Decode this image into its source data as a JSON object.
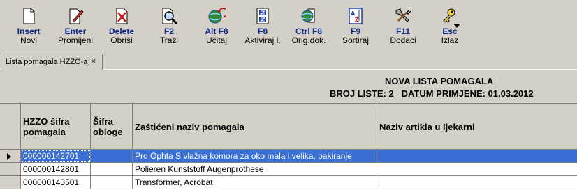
{
  "toolbar": {
    "buttons": [
      {
        "key": "Insert",
        "label": "Novi",
        "icon": "new-document-icon"
      },
      {
        "key": "Enter",
        "label": "Promijeni",
        "icon": "edit-document-icon"
      },
      {
        "key": "Delete",
        "label": "Obriši",
        "icon": "delete-document-icon"
      },
      {
        "key": "F2",
        "label": "Traži",
        "icon": "search-icon"
      },
      {
        "key": "Alt F8",
        "label": "Učitaj",
        "icon": "globe-refresh-icon"
      },
      {
        "key": "F8",
        "label": "Aktiviraj l.",
        "icon": "activate-list-icon"
      },
      {
        "key": "Ctrl F8",
        "label": "Orig.dok.",
        "icon": "globe-document-icon"
      },
      {
        "key": "F9",
        "label": "Sortiraj",
        "icon": "sort-az-icon"
      },
      {
        "key": "F11",
        "label": "Dodaci",
        "icon": "tools-icon"
      },
      {
        "key": "Esc",
        "label": "Izlaz",
        "icon": "exit-key-icon"
      }
    ]
  },
  "tab": {
    "label": "Lista pomagala HZZO-a",
    "close": "×"
  },
  "info": {
    "title": "NOVA LISTA POMAGALA",
    "line": "BROJ LISTE: 2   DATUM PRIMJENE: 01.03.2012"
  },
  "grid": {
    "columns": [
      {
        "line1": "HZZO šifra",
        "line2": "pomagala"
      },
      {
        "line1": "Šifra",
        "line2": "obloge"
      },
      {
        "line1": "Zaštićeni naziv pomagala",
        "line2": ""
      },
      {
        "line1": "Naziv artikla u ljekarni",
        "line2": ""
      }
    ],
    "rows": [
      {
        "code": "000000142701",
        "obloga": "",
        "name": "Pro Ophta S vlažna komora za oko mala i velika, pakiranje",
        "article": "",
        "selected": true
      },
      {
        "code": "000000142801",
        "obloga": "",
        "name": "Polieren Kunststoff Augenprothese",
        "article": "",
        "selected": false
      },
      {
        "code": "000000143501",
        "obloga": "",
        "name": "Transformer, Acrobat",
        "article": "",
        "selected": false
      }
    ]
  },
  "colors": {
    "selection": "#3a6fd6",
    "keyText": "#0b2a8c",
    "chrome": "#d4d0c8"
  }
}
